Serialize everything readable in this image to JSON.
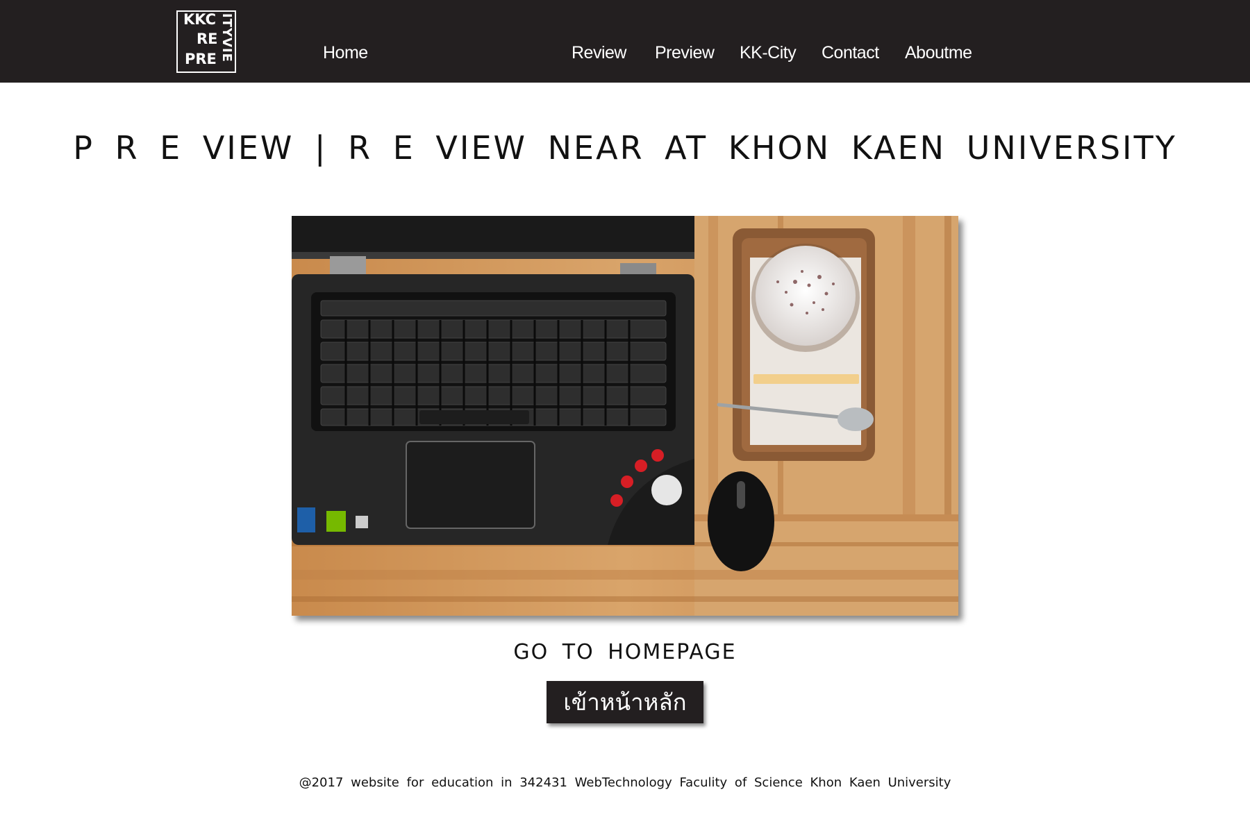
{
  "colors": {
    "nav_background": "#231f20",
    "nav_text": "#ffffff",
    "page_background": "#ffffff",
    "button_background": "#231f20",
    "button_text": "#ffffff"
  },
  "logo": {
    "line1": "KKC",
    "line2": "RE",
    "line3": "PRE",
    "vertical": "ITYVIE"
  },
  "nav": {
    "home": "Home",
    "review": "Review",
    "preview": "Preview",
    "kk_city": "KK-City",
    "contact": "Contact",
    "aboutme": "Aboutme"
  },
  "main": {
    "title": "P R E VIEW | R E VIEW NEAR AT KHON KAEN UNIVERSITY",
    "hero_image": "photo-laptop-coffee-mouse",
    "goto_label": "GO TO HOMEPAGE",
    "home_button_label": "เข้าหน้าหลัก"
  },
  "footer": {
    "text": "@2017 website for education in 342431 WebTechnology Faculity of Science Khon Kaen University"
  }
}
